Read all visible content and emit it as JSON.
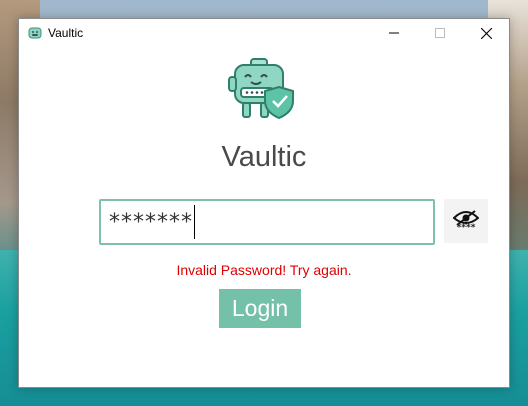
{
  "window": {
    "title": "Vaultic",
    "icon": "vaultic-app-icon",
    "controls": [
      "minimize-icon",
      "maximize-icon",
      "close-icon"
    ]
  },
  "app": {
    "title": "Vaultic",
    "logo": "vault-robot-shield-logo"
  },
  "login": {
    "password_value": "*******",
    "toggle_icon": "eye-slash-icon",
    "toggle_mask_text": "****",
    "error_message": "Invalid Password! Try again.",
    "button_label": "Login"
  },
  "colors": {
    "accent": "#74c0a8",
    "field_border": "#7fbfae",
    "error": "#e00000",
    "title_text": "#4a4a4a"
  }
}
